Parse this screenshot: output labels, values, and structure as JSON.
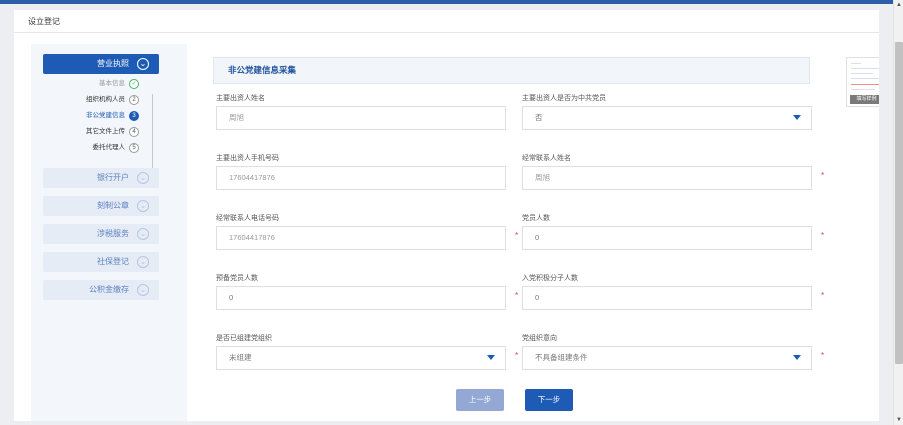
{
  "page": {
    "title": "设立登记"
  },
  "sidebar": {
    "steps": [
      {
        "label": "营业执照",
        "state": "active",
        "icon": "chevron-down-icon"
      },
      {
        "label": "银行开户",
        "state": "inactive",
        "icon": "chevron-down-icon"
      },
      {
        "label": "刻制公章",
        "state": "inactive",
        "icon": "chevron-down-icon"
      },
      {
        "label": "涉税服务",
        "state": "inactive",
        "icon": "chevron-down-icon"
      },
      {
        "label": "社保登记",
        "state": "inactive",
        "icon": "chevron-down-icon"
      },
      {
        "label": "公积金缴存",
        "state": "inactive",
        "icon": "chevron-down-icon"
      }
    ],
    "substeps": [
      {
        "label": "基本信息",
        "marker": "✓",
        "state": "done"
      },
      {
        "label": "组织机构人员",
        "marker": "2",
        "state": "todo"
      },
      {
        "label": "非公党建信息",
        "marker": "3",
        "state": "current"
      },
      {
        "label": "其它文件上传",
        "marker": "4",
        "state": "todo"
      },
      {
        "label": "委托代理人",
        "marker": "5",
        "state": "todo"
      }
    ]
  },
  "form": {
    "section_title": "非公党建信息采集",
    "fields": {
      "investor_name": {
        "label": "主要出资人姓名",
        "value": "周旭"
      },
      "investor_is_party_member": {
        "label": "主要出资人是否为中共党员",
        "value": "否"
      },
      "investor_phone": {
        "label": "主要出资人手机号码",
        "value": "17604417876"
      },
      "contact_name": {
        "label": "经常联系人姓名",
        "value": "周旭"
      },
      "contact_phone": {
        "label": "经常联系人电话号码",
        "value": "17604417876"
      },
      "party_member_count": {
        "label": "党员人数",
        "value": "0"
      },
      "probationary_count": {
        "label": "预备党员人数",
        "value": "0"
      },
      "activist_count": {
        "label": "入党积极分子人数",
        "value": "0"
      },
      "party_org_built": {
        "label": "是否已组建党组织",
        "value": "未组建"
      },
      "party_org_intention": {
        "label": "党组织意向",
        "value": "不具备组建条件"
      }
    },
    "required_mark": "*"
  },
  "buttons": {
    "prev": "上一步",
    "next": "下一步"
  },
  "thumbnail": {
    "button_label": "填写样例"
  },
  "colors": {
    "accent": "#1e5bb5",
    "required": "#e04040",
    "done": "#43b36a"
  }
}
